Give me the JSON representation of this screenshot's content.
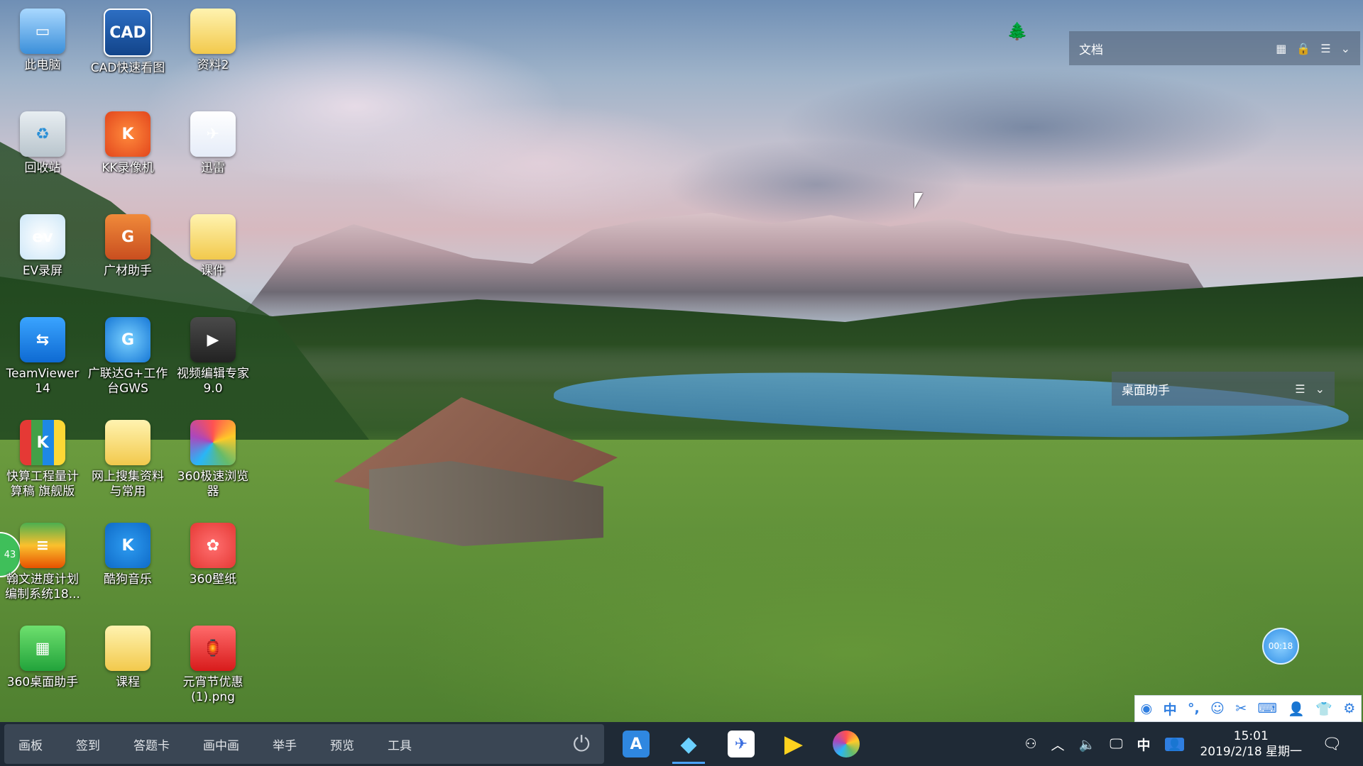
{
  "desktop_icons": [
    {
      "name": "this-pc",
      "label": "此电脑",
      "glyph": "▭"
    },
    {
      "name": "cad",
      "label": "CAD快速看图",
      "glyph": "CAD"
    },
    {
      "name": "folder-ziliao2",
      "label": "资料2",
      "glyph": ""
    },
    {
      "name": "recycle-bin",
      "label": "回收站",
      "glyph": "♻"
    },
    {
      "name": "kk-recorder",
      "label": "KK录像机",
      "glyph": "K"
    },
    {
      "name": "xunlei",
      "label": "迅雷",
      "glyph": "✈"
    },
    {
      "name": "ev-recorder",
      "label": "EV录屏",
      "glyph": "ev"
    },
    {
      "name": "guangcai",
      "label": "广材助手",
      "glyph": "G"
    },
    {
      "name": "folder-kejian",
      "label": "课件",
      "glyph": ""
    },
    {
      "name": "teamviewer",
      "label": "TeamViewer 14",
      "glyph": "⇆"
    },
    {
      "name": "gws",
      "label": "广联达G+工作台GWS",
      "glyph": "G"
    },
    {
      "name": "video-editor",
      "label": "视频编辑专家 9.0",
      "glyph": "▶"
    },
    {
      "name": "kuaisuan",
      "label": "快算工程量计算稿 旗舰版",
      "glyph": "K"
    },
    {
      "name": "folder-wangshang",
      "label": "网上搜集资料与常用",
      "glyph": ""
    },
    {
      "name": "360-browser",
      "label": "360极速浏览器",
      "glyph": ""
    },
    {
      "name": "hanwen",
      "label": "翰文进度计划编制系统18...",
      "glyph": "≡"
    },
    {
      "name": "kugou",
      "label": "酷狗音乐",
      "glyph": "K"
    },
    {
      "name": "360-wallpaper",
      "label": "360壁纸",
      "glyph": "✿"
    },
    {
      "name": "360-desktop",
      "label": "360桌面助手",
      "glyph": "▦"
    },
    {
      "name": "folder-kecheng",
      "label": "课程",
      "glyph": ""
    },
    {
      "name": "yuanxiao-png",
      "label": "元宵节优惠(1).png",
      "glyph": "🏮"
    }
  ],
  "widgets": {
    "docs": {
      "title": "文档"
    },
    "assistant": {
      "title": "桌面助手"
    }
  },
  "taskbar": {
    "tools": [
      "画板",
      "签到",
      "答题卡",
      "画中画",
      "举手",
      "预览",
      "工具"
    ],
    "clock_time": "15:01",
    "clock_date": "2019/2/18 星期一",
    "ime_lang": "中"
  },
  "ime_bar": {
    "lang": "中"
  },
  "timer": "00:18",
  "side_badge": "43",
  "colors": {
    "taskbar": "#1f2a36",
    "accent": "#4aa3ff"
  }
}
